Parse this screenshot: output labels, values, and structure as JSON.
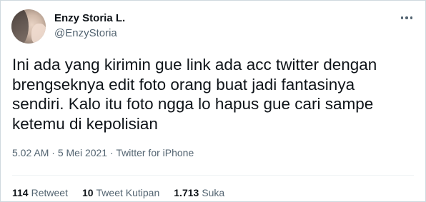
{
  "user": {
    "display_name": "Enzy Storia L.",
    "handle": "@EnzyStoria"
  },
  "tweet": {
    "text": "Ini ada yang kirimin gue link ada acc twitter dengan\nbrengseknya edit foto orang buat jadi fantasinya\nsendiri. Kalo itu foto ngga lo hapus gue cari sampe\nketemu di kepolisian",
    "time": "5.02 AM",
    "date": "5 Mei 2021",
    "source": "Twitter for iPhone",
    "separator": "·"
  },
  "stats": {
    "retweets": {
      "count": "114",
      "label": "Retweet"
    },
    "quotes": {
      "count": "10",
      "label": "Tweet Kutipan"
    },
    "likes": {
      "count": "1.713",
      "label": "Suka"
    }
  },
  "icons": {
    "more": "more-horizontal-icon",
    "avatar": "profile-avatar"
  }
}
